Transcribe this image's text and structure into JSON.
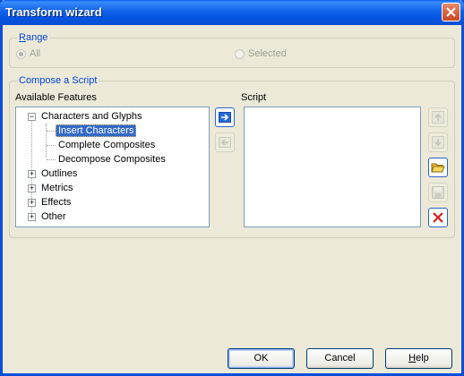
{
  "window": {
    "title": "Transform wizard"
  },
  "range": {
    "legend": "Range",
    "options": [
      {
        "label": "All",
        "selected": true,
        "enabled": false
      },
      {
        "label": "Selected",
        "selected": false,
        "enabled": false
      }
    ]
  },
  "compose": {
    "legend": "Compose a Script",
    "available_label": "Available Features",
    "script_label": "Script",
    "tree": {
      "root": "Characters and Glyphs",
      "children": [
        "Insert Characters",
        "Complete Composites",
        "Decompose Composites"
      ],
      "selected_child": "Insert Characters",
      "collapsed": [
        "Outlines",
        "Metrics",
        "Effects",
        "Other"
      ]
    },
    "script_items": []
  },
  "buttons": {
    "ok": "OK",
    "cancel": "Cancel",
    "help": "Help"
  },
  "colors": {
    "accent": "#316ac5",
    "group_title": "#0046d5",
    "delete": "#d62020"
  },
  "icons": {
    "add": "arrow-right-icon",
    "remove": "arrow-left-icon",
    "up": "arrow-up-icon",
    "down": "arrow-down-icon",
    "open": "folder-open-icon",
    "save": "save-icon",
    "delete": "delete-icon"
  }
}
